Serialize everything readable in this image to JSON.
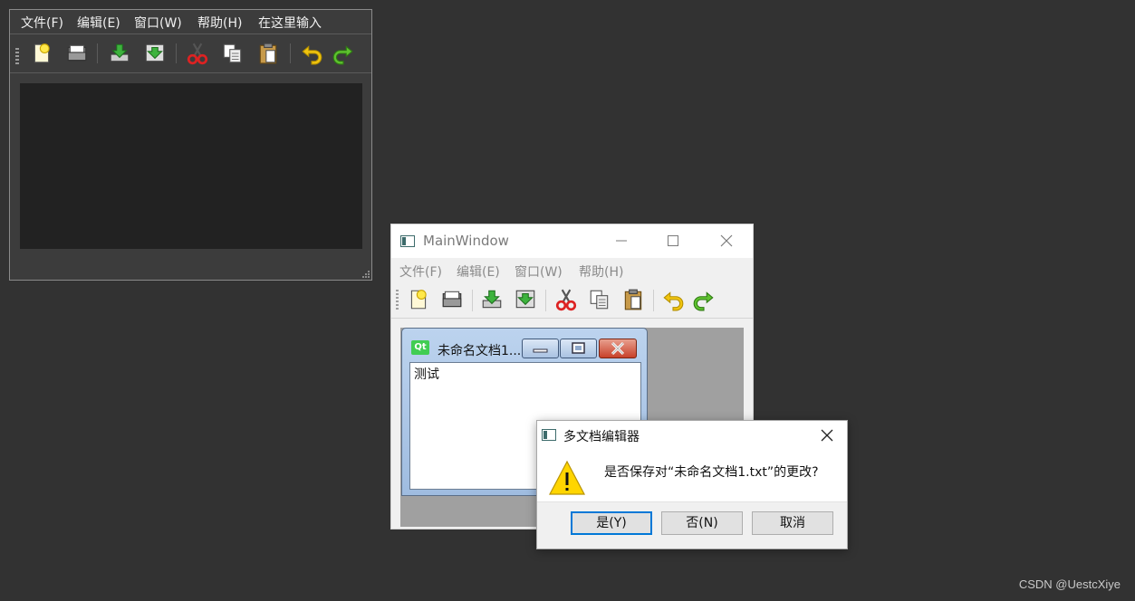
{
  "designer": {
    "menus": [
      "文件(F)",
      "编辑(E)",
      "窗口(W)",
      "帮助(H)",
      "在这里输入"
    ]
  },
  "main_window": {
    "title": "MainWindow",
    "menus": [
      "文件(F)",
      "编辑(E)",
      "窗口(W)",
      "帮助(H)"
    ],
    "toolbar_icons": [
      "new-file-icon",
      "open-folder-icon",
      "save-icon",
      "save-as-icon",
      "cut-icon",
      "copy-icon",
      "paste-icon",
      "undo-icon",
      "redo-icon"
    ]
  },
  "sub_window": {
    "badge": "Qt",
    "title": "未命名文档1...",
    "content": "测试"
  },
  "message_box": {
    "title": "多文档编辑器",
    "text": "是否保存对“未命名文档1.txt”的更改?",
    "buttons": [
      "是(Y)",
      "否(N)",
      "取消"
    ]
  },
  "watermark": "CSDN @UestcXiye"
}
